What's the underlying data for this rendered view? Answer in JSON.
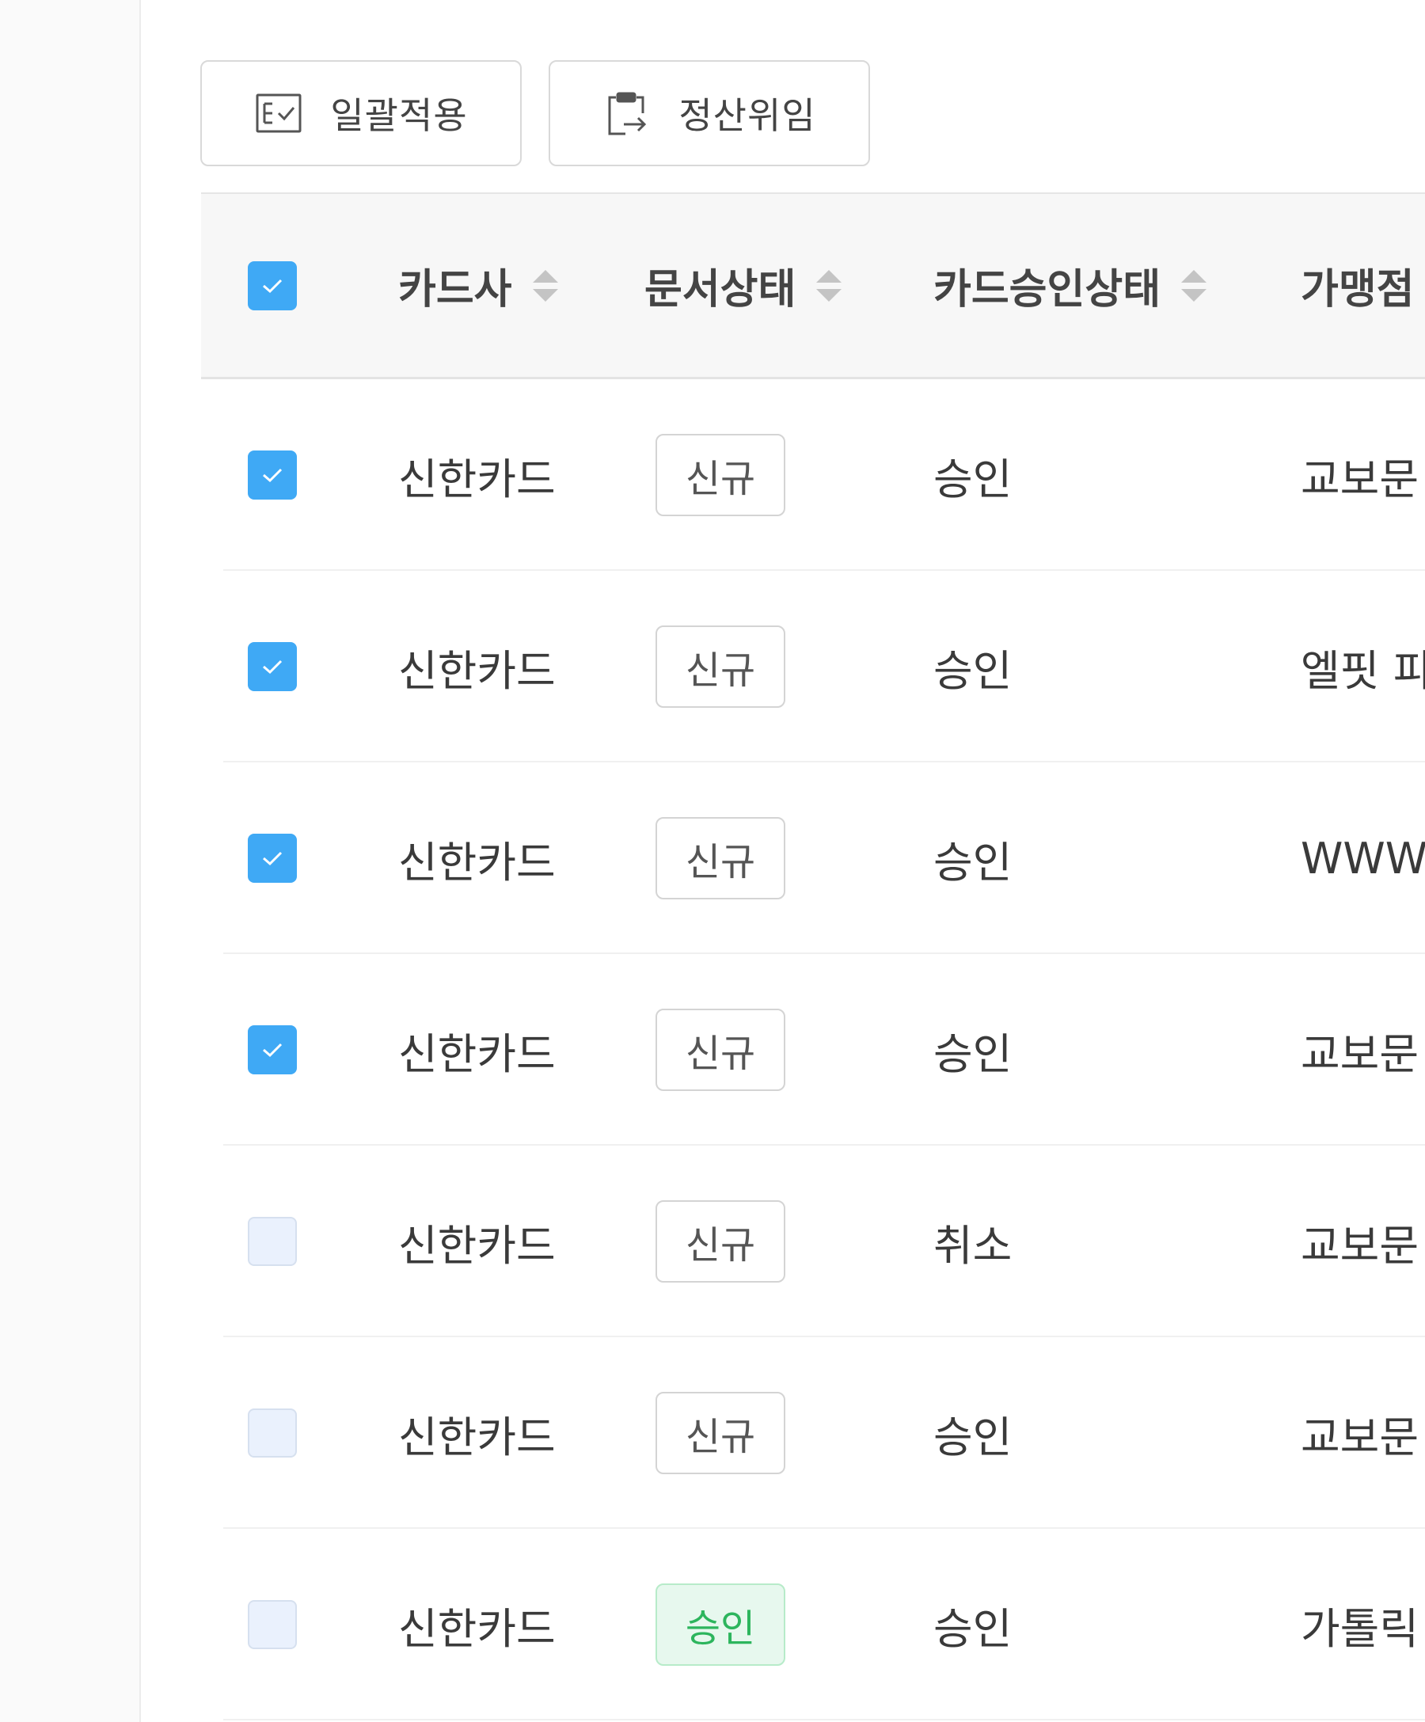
{
  "toolbar": {
    "bulk_apply_label": "일괄적용",
    "delegate_label": "정산위임"
  },
  "table": {
    "columns": [
      {
        "label": "카드사"
      },
      {
        "label": "문서상태"
      },
      {
        "label": "카드승인상태"
      },
      {
        "label": "가맹점"
      }
    ],
    "header_checked": true,
    "rows": [
      {
        "checked": true,
        "card_company": "신한카드",
        "doc_status": "신규",
        "doc_status_color": "#555555",
        "approval_status": "승인",
        "merchant": "교보문"
      },
      {
        "checked": true,
        "card_company": "신한카드",
        "doc_status": "신규",
        "doc_status_color": "#555555",
        "approval_status": "승인",
        "merchant": "엘핏 피"
      },
      {
        "checked": true,
        "card_company": "신한카드",
        "doc_status": "신규",
        "doc_status_color": "#555555",
        "approval_status": "승인",
        "merchant": "WWW"
      },
      {
        "checked": true,
        "card_company": "신한카드",
        "doc_status": "신규",
        "doc_status_color": "#555555",
        "approval_status": "승인",
        "merchant": "교보문"
      },
      {
        "checked": false,
        "card_company": "신한카드",
        "doc_status": "신규",
        "doc_status_color": "#555555",
        "approval_status": "취소",
        "merchant": "교보문"
      },
      {
        "checked": false,
        "card_company": "신한카드",
        "doc_status": "신규",
        "doc_status_color": "#555555",
        "approval_status": "승인",
        "merchant": "교보문"
      },
      {
        "checked": false,
        "card_company": "신한카드",
        "doc_status": "승인",
        "doc_status_color": "#2db55d",
        "approval_status": "승인",
        "merchant": "가톨릭"
      }
    ]
  },
  "colors": {
    "checkbox_checked": "#3fa9f5",
    "checkbox_unchecked": "#eaf1fd",
    "approved_tag_bg": "#e7f8ee",
    "approved_tag_text": "#2db55d"
  },
  "icons": {
    "bulk_apply": "checklist-icon",
    "delegate": "clipboard-transfer-icon",
    "sort": "sort-icon",
    "check": "check-icon"
  }
}
